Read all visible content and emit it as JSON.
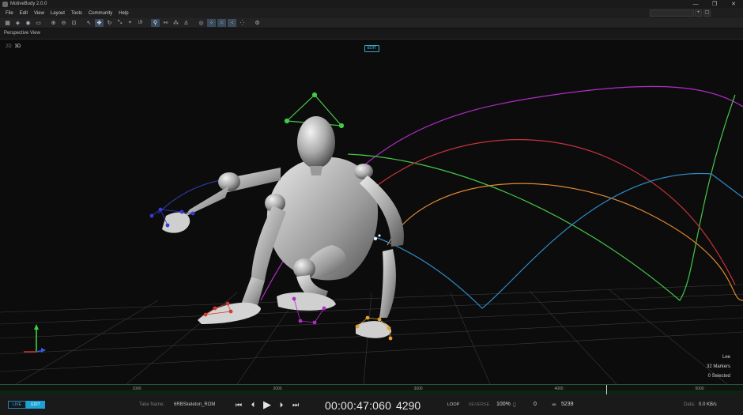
{
  "window": {
    "title": "MotiveBody 2.0.0",
    "minimize": "—",
    "restore": "❐",
    "close": "✕"
  },
  "menu": {
    "items": [
      "File",
      "Edit",
      "View",
      "Layout",
      "Tools",
      "Community",
      "Help"
    ],
    "search_placeholder": ""
  },
  "toolbar": {
    "icons": [
      "grid-icon",
      "layers-icon",
      "camera-icon",
      "view-icon",
      "zoom-in-icon",
      "zoom-out-icon",
      "zoom-fit-icon",
      "select-icon",
      "move-icon",
      "rotate-icon",
      "scale-icon",
      "snap-icon",
      "label-icon",
      "skeleton-icon",
      "bone-icon",
      "marker-icon",
      "body-icon",
      "eye-icon",
      "group-icon",
      "link-icon",
      "trajectory-icon",
      "cloud-icon",
      "settings-icon"
    ]
  },
  "view": {
    "title": "Perspective View",
    "mode_dim": "2D",
    "mode": "3D",
    "edit_badge": "EDIT"
  },
  "overlay": {
    "name": "Lee",
    "markers": "32 Markers",
    "selected": "0 Selected"
  },
  "timeline": {
    "ticks": [
      "1000",
      "2000",
      "3000",
      "4000",
      "5000"
    ],
    "playhead_frame": 4290
  },
  "controls": {
    "live": "LIVE",
    "edit": "EDIT",
    "take_label": "Take Name:",
    "take_value": "6RBSkeleton_ROM",
    "timecode": "00:00:47:060",
    "frame": "4290",
    "loop": "LOOP",
    "reverse": "REVERSE",
    "speed": "100%",
    "offset": "0",
    "end_frame": "5239",
    "data_label": "Data:",
    "data_value": "0.0 KB/s"
  },
  "colors": {
    "accent": "#1da0d4",
    "timeline_green": "#1f5f34",
    "trail_purple": "#b22cc9",
    "trail_green": "#46c84a",
    "trail_orange": "#e08a2e",
    "trail_blue": "#2d8ac6"
  }
}
